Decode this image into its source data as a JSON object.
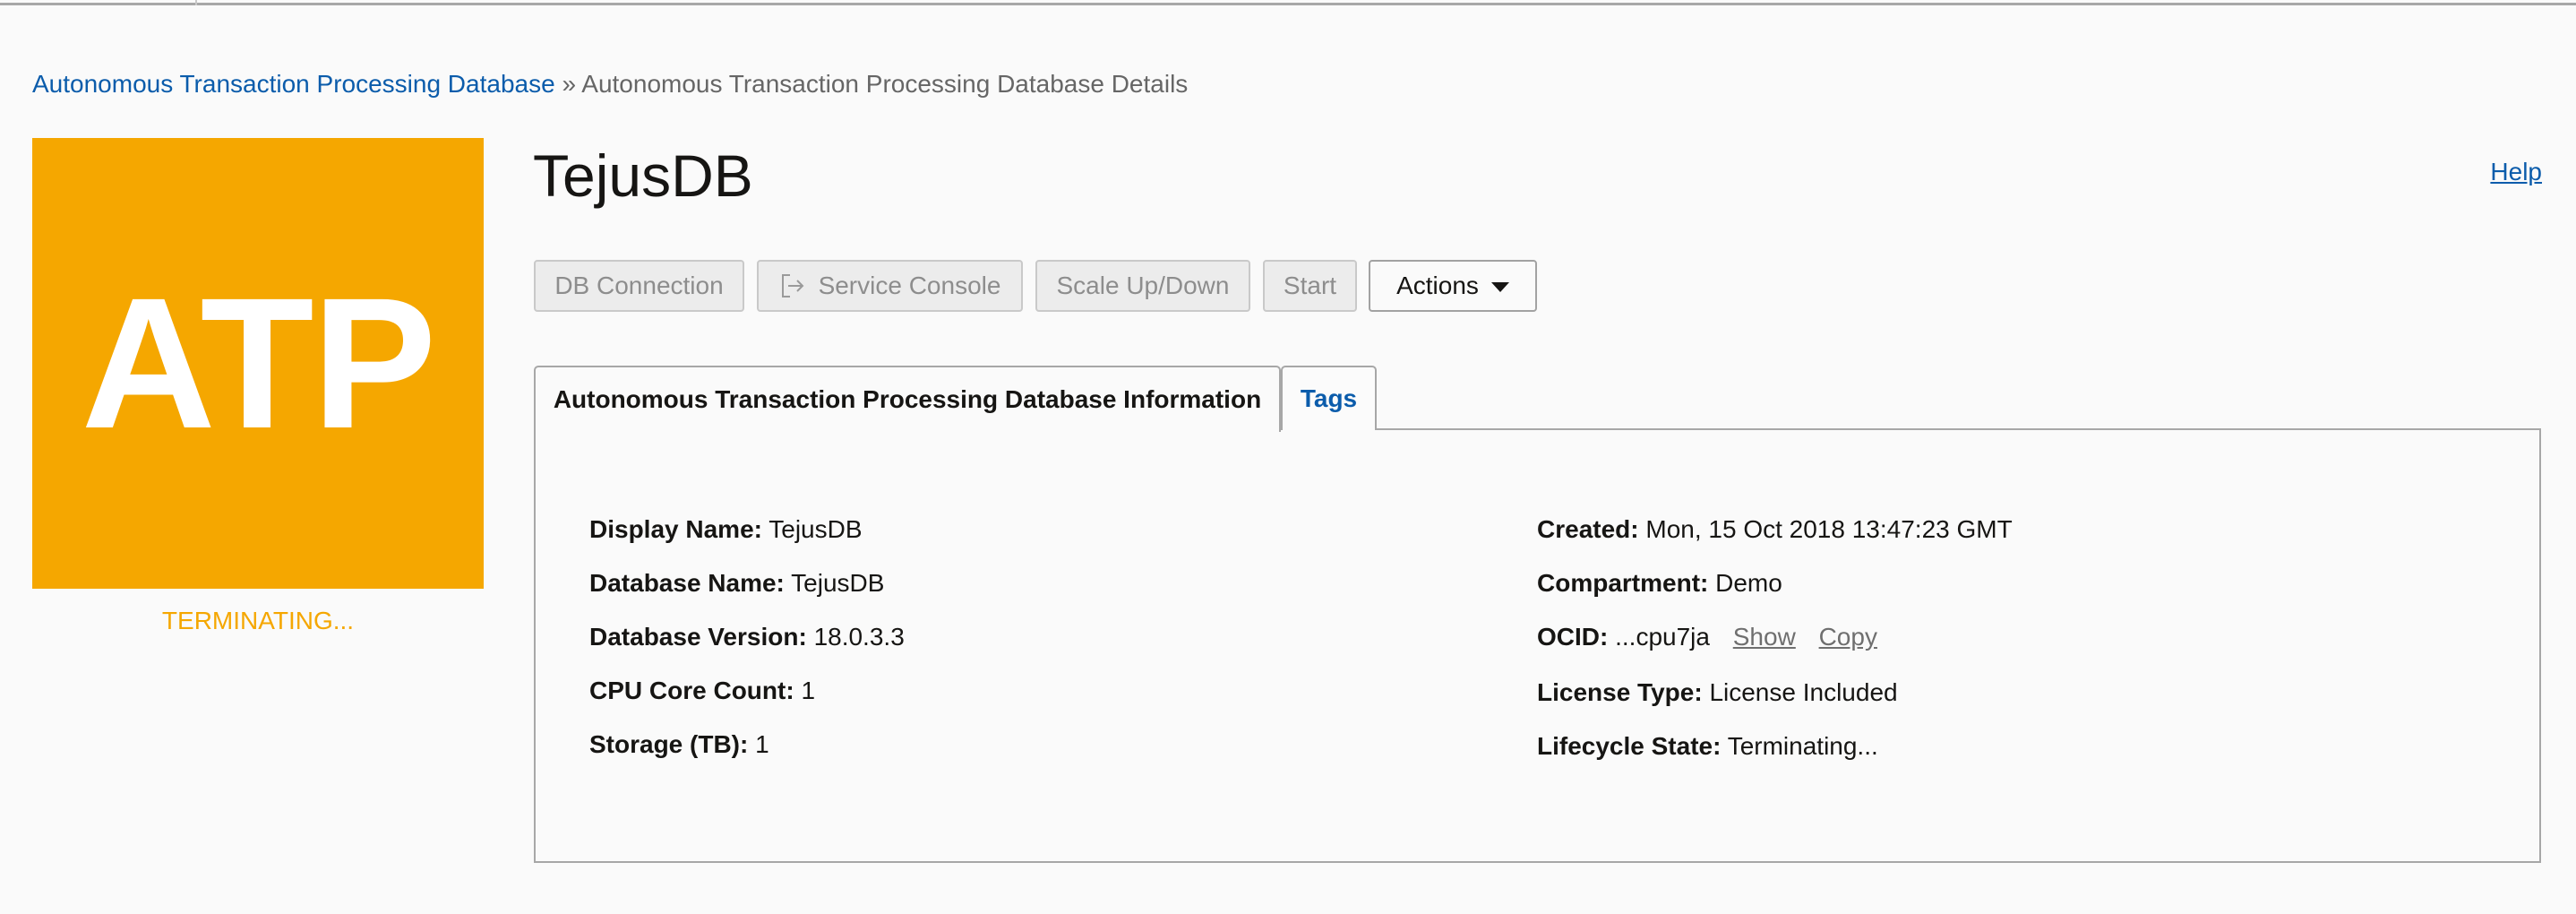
{
  "breadcrumb": {
    "parent": "Autonomous Transaction Processing Database",
    "separator": "»",
    "current": "Autonomous Transaction Processing Database Details"
  },
  "logo": {
    "text": "ATP",
    "color": "#f5a700"
  },
  "status": "TERMINATING...",
  "title": "TejusDB",
  "help_label": "Help",
  "toolbar": {
    "db_connection": "DB Connection",
    "service_console": "Service Console",
    "scale": "Scale Up/Down",
    "start": "Start",
    "actions": "Actions"
  },
  "tabs": [
    {
      "label": "Autonomous Transaction Processing Database Information"
    },
    {
      "label": "Tags"
    }
  ],
  "details_left": [
    {
      "label": "Display Name:",
      "value": "TejusDB"
    },
    {
      "label": "Database Name:",
      "value": "TejusDB"
    },
    {
      "label": "Database Version:",
      "value": "18.0.3.3"
    },
    {
      "label": "CPU Core Count:",
      "value": "1"
    },
    {
      "label": "Storage (TB):",
      "value": "1"
    }
  ],
  "details_right": [
    {
      "label": "Created:",
      "value": "Mon, 15 Oct 2018 13:47:23 GMT"
    },
    {
      "label": "Compartment:",
      "value": "Demo"
    },
    {
      "label": "OCID:",
      "value": "...cpu7ja",
      "show_label": "Show",
      "copy_label": "Copy"
    },
    {
      "label": "License Type:",
      "value": "License Included"
    },
    {
      "label": "Lifecycle State:",
      "value": "Terminating..."
    }
  ],
  "colors": {
    "link": "#0b5cab",
    "accent": "#f5a700"
  }
}
